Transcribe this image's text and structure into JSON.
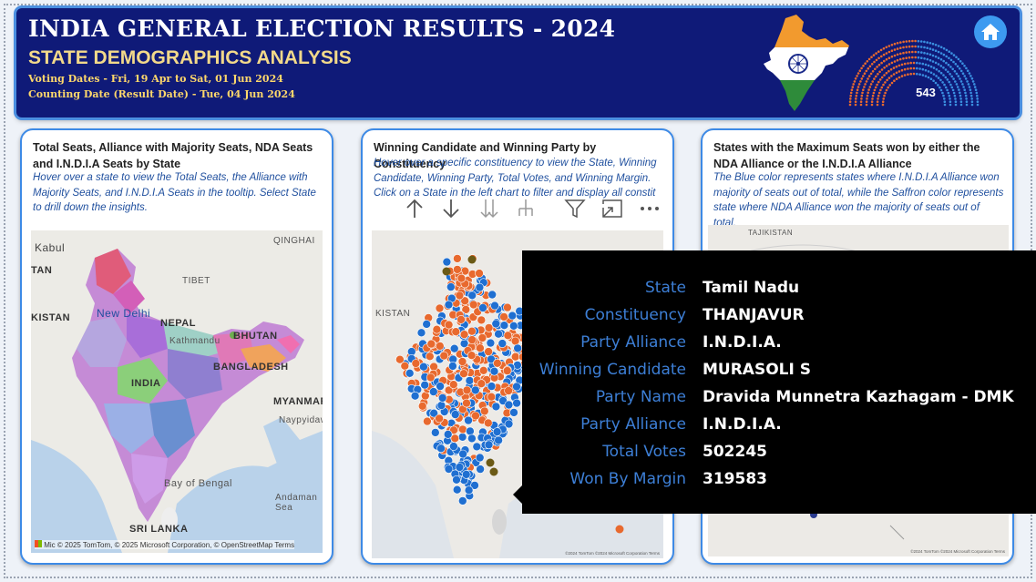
{
  "header": {
    "title": "INDIA GENERAL ELECTION RESULTS - 2024",
    "subtitle": "STATE DEMOGRAPHICS ANALYSIS",
    "voting_dates": "Voting Dates - Fri, 19 Apr to Sat, 01 Jun 2024",
    "counting_date": "Counting Date (Result Date) - Tue, 04 Jun 2024",
    "total_seats": "543",
    "home_icon": "home-icon"
  },
  "cards": [
    {
      "title": "Total Seats, Alliance with Majority Seats, NDA Seats and I.N.D.I.A Seats by State",
      "description": "Hover over a state to view the Total Seats, the Alliance with Majority Seats, and I.N.D.I.A Seats in the tooltip. Select State to drill down the insights.",
      "map_labels": [
        "Kabul",
        "QINGHAI",
        "TAN",
        "TIBET",
        "KISTAN",
        "New Delhi",
        "NEPAL",
        "Kathmandu",
        "BHUTAN",
        "INDIA",
        "BANGLADESH",
        "MYANMAR",
        "Naypyidaw",
        "Bay of Bengal",
        "Andaman Sea",
        "SRI LANKA"
      ],
      "attribution": "© 2025 TomTom, © 2025 Microsoft Corporation, © OpenStreetMap  Terms",
      "brand": "Mic"
    },
    {
      "title": "Winning Candidate and Winning Party by Constituency",
      "description": "Hover over a specific constituency to view the State, Winning Candidate, Winning Party, Total Votes, and Winning Margin. Click on a State in the left chart to filter and display all constit",
      "map_labels": [
        "KISTAN"
      ],
      "attribution": "©2024 TomTom ©2024 Microsoft Corporation  Terms"
    },
    {
      "title": "States with the Maximum Seats won by either the NDA Alliance or the I.N.D.I.A Alliance",
      "description": "The Blue color represents states where I.N.D.I.A Alliance won majority of seats out of total, while the Saffron color represents state where NDA Alliance won the majority of seats out of total.",
      "map_labels": [
        "TAJIKISTAN"
      ],
      "attribution": "©2024 TomTom ©2024 Microsoft Corporation  Terms"
    }
  ],
  "toolbar": {
    "icons": [
      "drill-up-icon",
      "drill-down-icon",
      "expand-next-level-icon",
      "expand-hierarchy-icon",
      "filter-icon",
      "focus-mode-icon",
      "more-options-icon"
    ]
  },
  "tooltip": {
    "rows": [
      {
        "key": "State",
        "value": "Tamil Nadu"
      },
      {
        "key": "Constituency",
        "value": "THANJAVUR"
      },
      {
        "key": "Party Alliance",
        "value": "I.N.D.I.A."
      },
      {
        "key": "Winning Candidate",
        "value": "MURASOLI S"
      },
      {
        "key": "Party Name",
        "value": "Dravida Munnetra Kazhagam - DMK"
      },
      {
        "key": "Party Alliance",
        "value": "I.N.D.I.A."
      },
      {
        "key": "Total Votes",
        "value": "502245"
      },
      {
        "key": "Won By Margin",
        "value": "319583"
      }
    ]
  },
  "colors": {
    "header_bg": "#0f1a78",
    "india_blue": "#1f6fd1",
    "nda_saffron": "#e8692e",
    "tooltip_key": "#3d7fd6"
  }
}
